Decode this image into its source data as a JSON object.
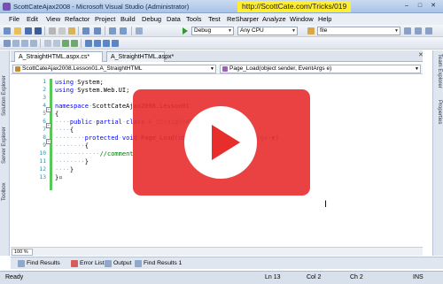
{
  "window": {
    "title": "ScottCateAjax2008 - Microsoft Visual Studio (Administrator)",
    "url_overlay": "http://ScottCate.com/Tricks/019",
    "controls": [
      "‒",
      "□",
      "✕"
    ]
  },
  "menu": [
    "File",
    "Edit",
    "View",
    "Refactor",
    "Project",
    "Build",
    "Debug",
    "Data",
    "Tools",
    "Test",
    "ReSharper",
    "Analyze",
    "Window",
    "Help"
  ],
  "toolbar": {
    "configuration": "Debug",
    "platform": "Any CPU",
    "find": "file"
  },
  "tabs": [
    {
      "label": "A_StraightHTML.aspx.cs*",
      "active": true
    },
    {
      "label": "A_StraightHTML.aspx*",
      "active": false
    }
  ],
  "tab_close": "✕",
  "navigation": {
    "class_combo": "ScottCateAjax2008.Lesson01.A_StraightHTML",
    "member_combo": "Page_Load(object sender, EventArgs e)"
  },
  "left_dock": [
    "Solution Explorer",
    "Server Explorer",
    "Toolbox"
  ],
  "right_dock": [
    "Team Explorer",
    "Properties"
  ],
  "editor": {
    "line_numbers": [
      "1",
      "2",
      "3",
      "4",
      "5",
      "6",
      "7",
      "8",
      "9",
      "10",
      "11",
      "12",
      "13"
    ],
    "lines": [
      {
        "parts": [
          {
            "t": "kw",
            "v": "using"
          },
          {
            "t": "dot",
            "v": "·"
          },
          {
            "t": "pl",
            "v": "System;"
          }
        ]
      },
      {
        "parts": [
          {
            "t": "kw",
            "v": "using"
          },
          {
            "t": "dot",
            "v": "·"
          },
          {
            "t": "pl",
            "v": "System.Web.UI;"
          }
        ]
      },
      {
        "parts": []
      },
      {
        "parts": [
          {
            "t": "kw",
            "v": "namespace"
          },
          {
            "t": "dot",
            "v": "·"
          },
          {
            "t": "pl",
            "v": "ScottCateAjax2008.Lesson01"
          }
        ]
      },
      {
        "parts": [
          {
            "t": "pl",
            "v": "{"
          }
        ]
      },
      {
        "parts": [
          {
            "t": "dot",
            "v": "····"
          },
          {
            "t": "kw",
            "v": "public"
          },
          {
            "t": "dot",
            "v": "·"
          },
          {
            "t": "kw",
            "v": "partial"
          },
          {
            "t": "dot",
            "v": "·"
          },
          {
            "t": "kw",
            "v": "class"
          },
          {
            "t": "dot",
            "v": "·"
          },
          {
            "t": "ty",
            "v": "A_StraightHTML"
          },
          {
            "t": "pl",
            "v": "·:·"
          },
          {
            "t": "ty",
            "v": "Page"
          }
        ]
      },
      {
        "parts": [
          {
            "t": "dot",
            "v": "····"
          },
          {
            "t": "pl",
            "v": "{"
          }
        ]
      },
      {
        "parts": [
          {
            "t": "dot",
            "v": "········"
          },
          {
            "t": "kw",
            "v": "protected"
          },
          {
            "t": "dot",
            "v": "·"
          },
          {
            "t": "kw",
            "v": "void"
          },
          {
            "t": "dot",
            "v": "·"
          },
          {
            "t": "pl",
            "v": "Page_Load("
          },
          {
            "t": "kw",
            "v": "object"
          },
          {
            "t": "pl",
            "v": "·sender,·"
          },
          {
            "t": "ty",
            "v": "EventArgs"
          },
          {
            "t": "pl",
            "v": "·e)"
          }
        ]
      },
      {
        "parts": [
          {
            "t": "dot",
            "v": "········"
          },
          {
            "t": "pl",
            "v": "{"
          }
        ]
      },
      {
        "parts": [
          {
            "t": "dot",
            "v": "············"
          },
          {
            "t": "cm",
            "v": "//comment"
          }
        ]
      },
      {
        "parts": [
          {
            "t": "dot",
            "v": "········"
          },
          {
            "t": "pl",
            "v": "}"
          }
        ]
      },
      {
        "parts": [
          {
            "t": "dot",
            "v": "····"
          },
          {
            "t": "pl",
            "v": "}"
          }
        ]
      },
      {
        "parts": [
          {
            "t": "pl",
            "v": "}"
          },
          {
            "t": "cm",
            "v": "¤"
          }
        ]
      }
    ],
    "zoom": "100 %"
  },
  "video_overlay": {
    "state": "paused"
  },
  "bottom_tabs": [
    "Find Results",
    "Error List",
    "Output",
    "Find Results 1"
  ],
  "status": {
    "ready": "Ready",
    "line": "Ln 13",
    "col": "Col 2",
    "ch": "Ch 2",
    "mode": "INS"
  },
  "colors": {
    "keyword": "#0000ff",
    "type": "#2b91af",
    "comment": "#008000",
    "overlay": "#e82d2d",
    "url_highlight": "#ffee33"
  }
}
